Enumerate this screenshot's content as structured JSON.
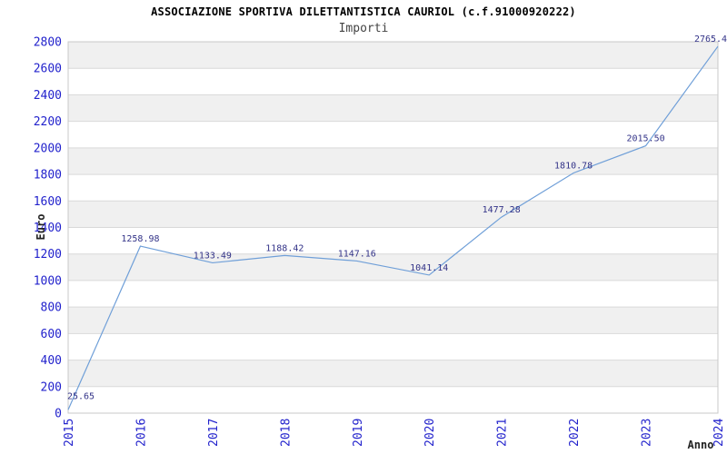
{
  "chart_data": {
    "type": "line",
    "title": "ASSOCIAZIONE SPORTIVA DILETTANTISTICA CAURIOL (c.f.91000920222)",
    "subtitle": "Importi",
    "xlabel": "Anno",
    "ylabel": "Euro",
    "categories": [
      "2015",
      "2016",
      "2017",
      "2018",
      "2019",
      "2020",
      "2021",
      "2022",
      "2023",
      "2024"
    ],
    "values": [
      25.65,
      1258.98,
      1133.49,
      1188.42,
      1147.16,
      1041.14,
      1477.28,
      1810.78,
      2015.5,
      2765.4
    ],
    "point_labels": [
      "25.65",
      "1258.98",
      "1133.49",
      "1188.42",
      "1147.16",
      "1041.14",
      "1477.28",
      "1810.78",
      "2015.50",
      "2765.4"
    ],
    "ylim": [
      0,
      2800
    ],
    "y_tick_step": 200,
    "grid": true,
    "legend": "none",
    "colors": {
      "line": "#6f9fd8",
      "tick_label": "#2222cc",
      "value_label": "#333388",
      "band": "#f0f0f0",
      "band_alt": "#ffffff",
      "grid": "#d9d9d9",
      "border": "#c9c9c9",
      "axis_title": "#222222",
      "title": "#000000",
      "subtitle": "#444444"
    }
  }
}
